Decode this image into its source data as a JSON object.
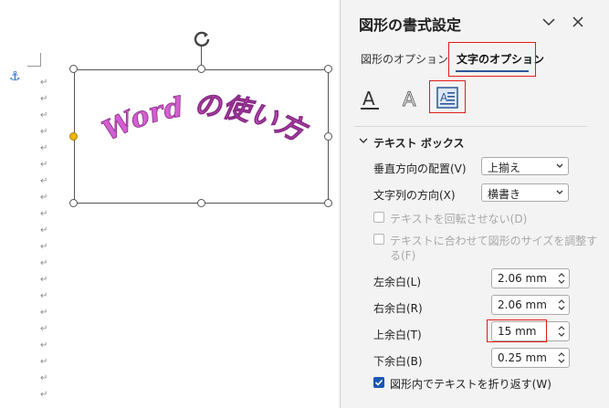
{
  "panel": {
    "title": "図形の書式設定",
    "tabs": [
      {
        "label": "図形のオプション",
        "active": false
      },
      {
        "label": "文字のオプション",
        "active": true
      }
    ],
    "icons": [
      {
        "name": "text-fill-outline-icon",
        "selected": false
      },
      {
        "name": "text-effects-icon",
        "selected": false
      },
      {
        "name": "textbox-layout-icon",
        "selected": true
      }
    ],
    "section_title": "テキスト ボックス",
    "vertical_align": {
      "label": "垂直方向の配置(V)",
      "value": "上揃え"
    },
    "text_direction": {
      "label": "文字列の方向(X)",
      "value": "横書き"
    },
    "no_rotate": {
      "label": "テキストを回転させない(D)",
      "checked": false,
      "disabled": true
    },
    "resize_shape": {
      "label_line1": "テキストに合わせて図形のサイズを調整す",
      "label_line2": "る(F)",
      "checked": false,
      "disabled": true
    },
    "margins": [
      {
        "label": "左余白(L)",
        "value": "2.06 mm"
      },
      {
        "label": "右余白(R)",
        "value": "2.06 mm"
      },
      {
        "label": "上余白(T)",
        "value": "15 mm"
      },
      {
        "label": "下余白(B)",
        "value": "0.25 mm"
      }
    ],
    "wrap_text": {
      "label": "図形内でテキストを折り返す(W)",
      "checked": true
    }
  },
  "document": {
    "wordart_text": "Word の使い方",
    "wordart_color": "#c44fc0"
  },
  "colors": {
    "accent": "#2b5797",
    "highlight": "#e21b1b",
    "checkbox": "#1a56b6"
  }
}
